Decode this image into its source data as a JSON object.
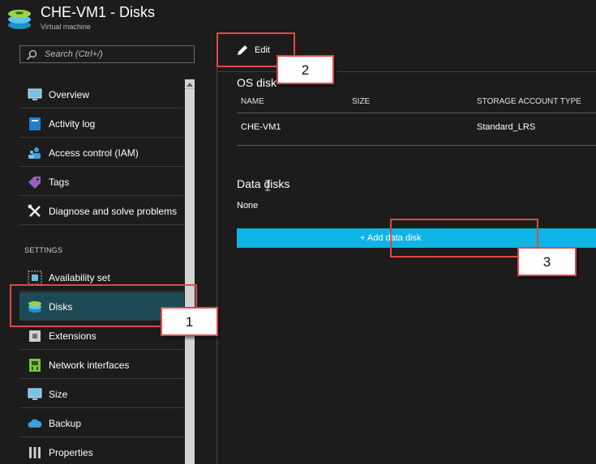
{
  "header": {
    "title": "CHE-VM1 - Disks",
    "subtitle": "Virtual machine"
  },
  "search": {
    "placeholder": "Search (Ctrl+/)"
  },
  "sidebar": {
    "items": [
      {
        "label": "Overview",
        "icon": "monitor-icon"
      },
      {
        "label": "Activity log",
        "icon": "log-icon"
      },
      {
        "label": "Access control (IAM)",
        "icon": "users-icon"
      },
      {
        "label": "Tags",
        "icon": "tag-icon"
      },
      {
        "label": "Diagnose and solve problems",
        "icon": "wrench-icon"
      }
    ],
    "settings_label": "SETTINGS",
    "settings_items": [
      {
        "label": "Availability set",
        "icon": "availability-set-icon"
      },
      {
        "label": "Disks",
        "icon": "disk-icon",
        "active": true
      },
      {
        "label": "Extensions",
        "icon": "extensions-icon"
      },
      {
        "label": "Network interfaces",
        "icon": "network-icon"
      },
      {
        "label": "Size",
        "icon": "size-icon"
      },
      {
        "label": "Backup",
        "icon": "cloud-icon"
      },
      {
        "label": "Properties",
        "icon": "properties-icon"
      }
    ]
  },
  "toolbar": {
    "edit_label": "Edit"
  },
  "os_disk": {
    "heading": "OS disk",
    "columns": [
      "NAME",
      "SIZE",
      "STORAGE ACCOUNT TYPE"
    ],
    "rows": [
      {
        "name": "CHE-VM1",
        "size": "",
        "storage_account_type": "Standard_LRS"
      }
    ]
  },
  "data_disks": {
    "heading": "Data disks",
    "empty_text": "None",
    "add_label": "+ Add data disk"
  },
  "callouts": [
    "1",
    "2",
    "3"
  ],
  "colors": {
    "background": "#1c1c1c",
    "active_item": "#1e4a55",
    "add_bar": "#0fb4e6",
    "annotation_red": "#e04848"
  }
}
